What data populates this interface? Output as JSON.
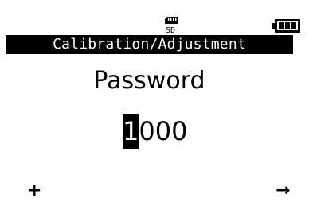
{
  "status": {
    "sd_icon": "sd-card-icon",
    "sd_label": "SD",
    "battery_icon": "battery-full-icon"
  },
  "header": {
    "title": "Calibration/Adjustment"
  },
  "main": {
    "prompt": "Password",
    "password_digits": [
      "1",
      "0",
      "0",
      "0"
    ],
    "cursor_index": 0
  },
  "softkeys": {
    "left_label": "+",
    "right_label": "→"
  },
  "colors": {
    "foreground": "#000000",
    "background": "#ffffff"
  }
}
